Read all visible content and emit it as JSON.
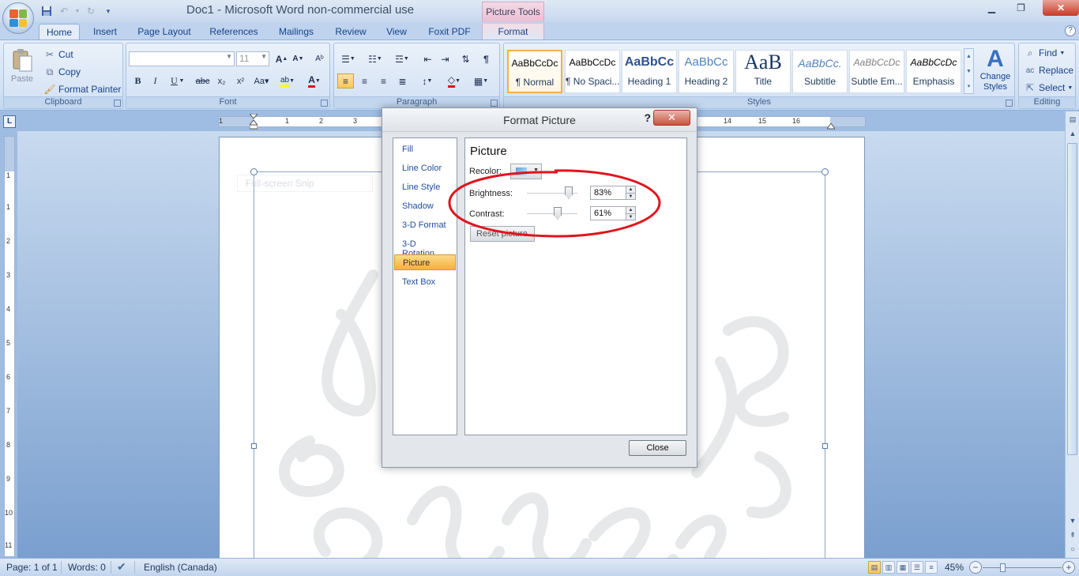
{
  "window": {
    "title": "Doc1 - Microsoft Word non-commercial use",
    "context_tab_header": "Picture Tools"
  },
  "tabs": [
    "Home",
    "Insert",
    "Page Layout",
    "References",
    "Mailings",
    "Review",
    "View",
    "Foxit PDF",
    "Format"
  ],
  "ribbon": {
    "clipboard": {
      "label": "Clipboard",
      "paste": "Paste",
      "cut": "Cut",
      "copy": "Copy",
      "format_painter": "Format Painter"
    },
    "font": {
      "label": "Font",
      "font_name": "",
      "font_size": "11"
    },
    "paragraph": {
      "label": "Paragraph"
    },
    "styles": {
      "label": "Styles",
      "items": [
        {
          "sample": "AaBbCcDc",
          "name": "¶ Normal"
        },
        {
          "sample": "AaBbCcDc",
          "name": "¶ No Spaci..."
        },
        {
          "sample": "AaBbCc",
          "name": "Heading 1"
        },
        {
          "sample": "AaBbCc",
          "name": "Heading 2"
        },
        {
          "sample": "AaB",
          "name": "Title"
        },
        {
          "sample": "AaBbCc.",
          "name": "Subtitle"
        },
        {
          "sample": "AaBbCcDc",
          "name": "Subtle Em..."
        },
        {
          "sample": "AaBbCcDc",
          "name": "Emphasis"
        }
      ],
      "change_styles": "Change Styles"
    },
    "editing": {
      "label": "Editing",
      "find": "Find",
      "replace": "Replace",
      "select": "Select"
    }
  },
  "ruler": {
    "numbers": [
      "1",
      "1",
      "2",
      "3",
      "14",
      "15",
      "16"
    ],
    "vertical_numbers": [
      "1",
      "1",
      "2",
      "3",
      "4",
      "5",
      "6",
      "7",
      "8",
      "9",
      "10",
      "11"
    ]
  },
  "document": {
    "snip_label": "Full-screen Snip"
  },
  "dialog": {
    "title": "Format Picture",
    "help": "?",
    "nav": [
      "Fill",
      "Line Color",
      "Line Style",
      "Shadow",
      "3-D Format",
      "3-D Rotation",
      "Picture",
      "Text Box"
    ],
    "selected_nav": "Picture",
    "panel_heading": "Picture",
    "recolor_label": "Recolor:",
    "brightness_label": "Brightness:",
    "brightness_value": "83%",
    "brightness_level": 0.83,
    "contrast_label": "Contrast:",
    "contrast_value": "61%",
    "contrast_level": 0.61,
    "reset_label": "Reset picture",
    "close_label": "Close"
  },
  "statusbar": {
    "page": "Page: 1 of 1",
    "words": "Words: 0",
    "language": "English (Canada)",
    "zoom": "45%",
    "zoom_level": 0.45
  },
  "colors": {
    "annotation": "#e0141e",
    "selected_nav": "#f6b03b"
  }
}
